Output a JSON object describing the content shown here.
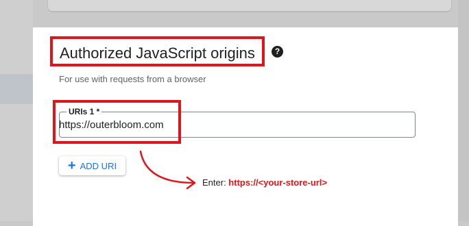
{
  "section": {
    "title": "Authorized JavaScript origins",
    "help_icon": "?",
    "subtitle": "For use with requests from a browser"
  },
  "uri_field": {
    "label": "URIs 1 *",
    "value": "https://outerbloom.com"
  },
  "add_button": {
    "icon": "+",
    "label": "ADD URI"
  },
  "annotation": {
    "prefix": "Enter: ",
    "url": "https://<your-store-url>"
  },
  "colors": {
    "highlight": "#e0151a",
    "accent": "#1a73e8"
  }
}
